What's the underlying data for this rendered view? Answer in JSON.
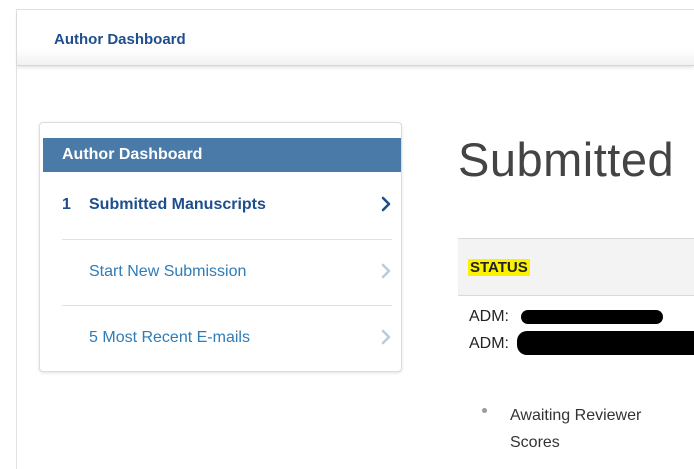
{
  "header": {
    "title": "Author Dashboard"
  },
  "sidebar": {
    "title": "Author Dashboard",
    "items": [
      {
        "count": "1",
        "label": "Submitted Manuscripts",
        "active": true
      },
      {
        "count": "",
        "label": "Start New Submission",
        "active": false
      },
      {
        "count": "5",
        "label": "Most Recent E-mails",
        "active": false
      }
    ]
  },
  "main": {
    "title": "Submitted",
    "table": {
      "status_header": "STATUS",
      "rows": [
        {
          "adm_lines": [
            {
              "prefix": "ADM:"
            },
            {
              "prefix": "ADM:"
            }
          ],
          "status_items": [
            "Awaiting Reviewer Scores"
          ]
        }
      ]
    }
  },
  "colors": {
    "brand_blue": "#1f4e8c",
    "link_blue": "#2e7cb8",
    "sidebar_header": "#4a7aa8",
    "highlight": "#fbf200"
  }
}
